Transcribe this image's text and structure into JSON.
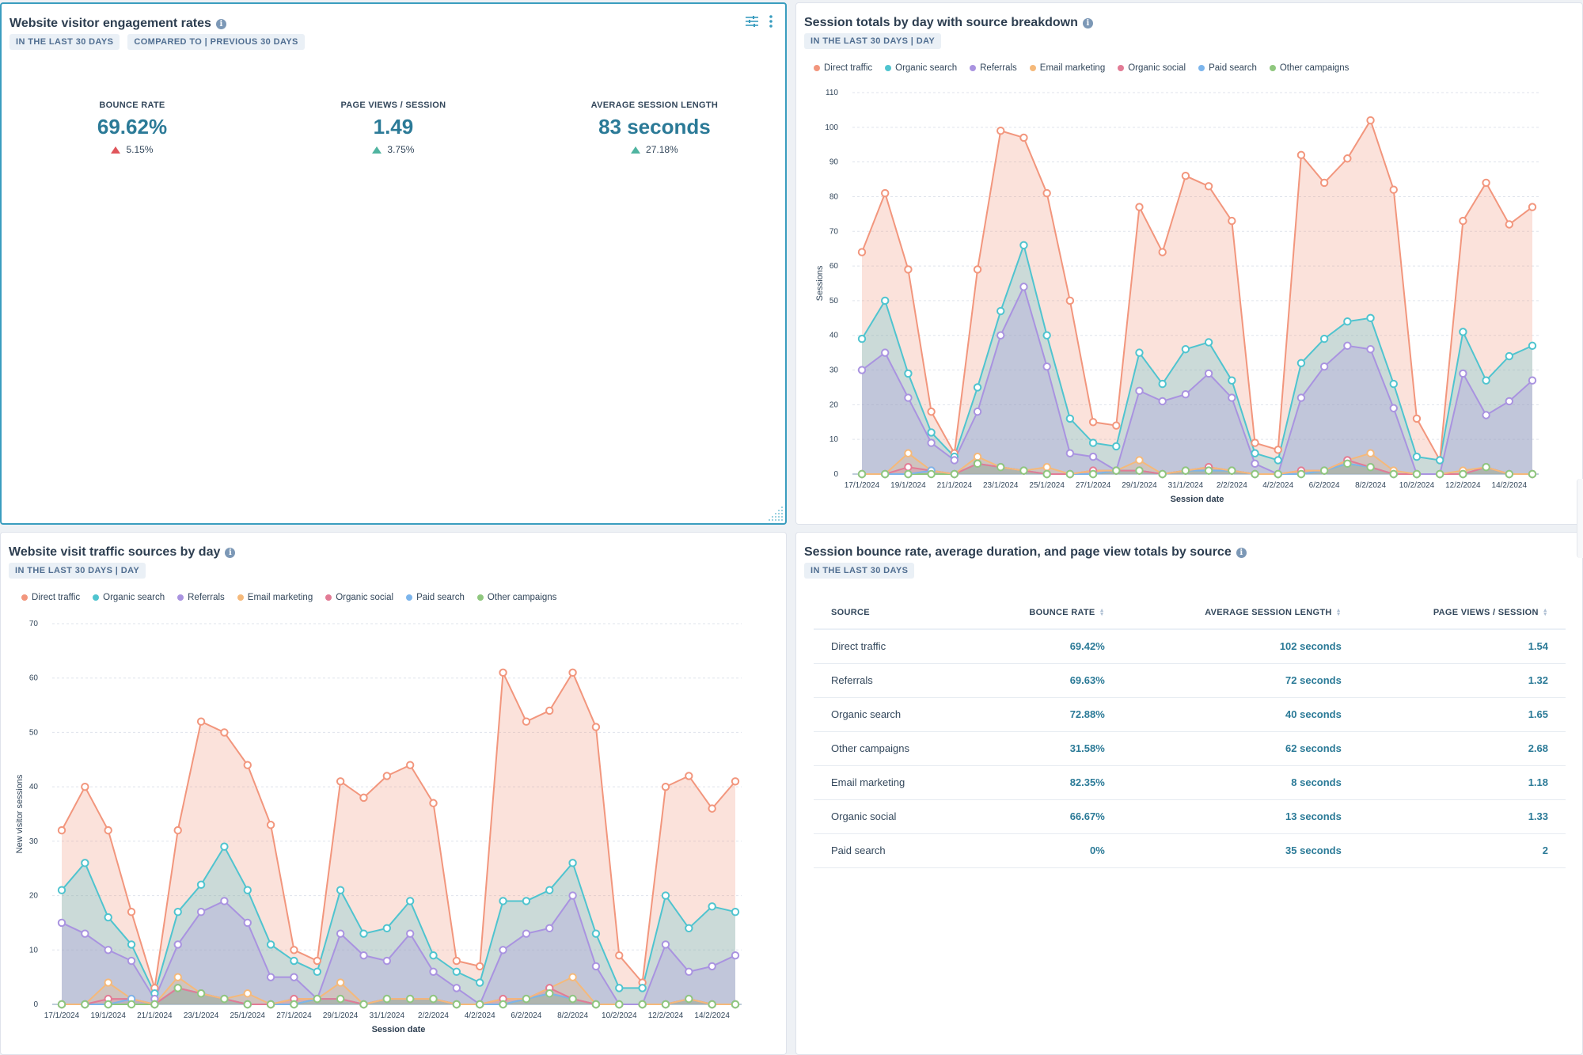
{
  "engagement": {
    "title": "Website visitor engagement rates",
    "tags": [
      "IN THE LAST 30 DAYS",
      "COMPARED TO | PREVIOUS 30 DAYS"
    ],
    "kpis": [
      {
        "label": "BOUNCE RATE",
        "value": "69.62%",
        "change": "5.15%",
        "direction": "up",
        "sentiment": "negative"
      },
      {
        "label": "PAGE VIEWS / SESSION",
        "value": "1.49",
        "change": "3.75%",
        "direction": "up",
        "sentiment": "positive"
      },
      {
        "label": "AVERAGE SESSION LENGTH",
        "value": "83 seconds",
        "change": "27.18%",
        "direction": "up",
        "sentiment": "positive"
      }
    ],
    "icons": {
      "filter": "sliders-icon",
      "menu": "more-vertical-icon"
    }
  },
  "legend": [
    {
      "name": "Direct traffic",
      "color": "#f2967d"
    },
    {
      "name": "Organic search",
      "color": "#4fc4cf"
    },
    {
      "name": "Referrals",
      "color": "#a993e0"
    },
    {
      "name": "Email marketing",
      "color": "#f5b97a"
    },
    {
      "name": "Organic social",
      "color": "#e27b95"
    },
    {
      "name": "Paid search",
      "color": "#7cb5ec"
    },
    {
      "name": "Other campaigns",
      "color": "#8fc77e"
    }
  ],
  "sessions_card": {
    "title": "Session totals by day with source breakdown",
    "tags": [
      "IN THE LAST 30 DAYS | DAY"
    ]
  },
  "traffic_card": {
    "title": "Website visit traffic sources by day",
    "tags": [
      "IN THE LAST 30 DAYS | DAY"
    ]
  },
  "chart_data": [
    {
      "type": "area",
      "stacked": true,
      "title": "Session totals by day with source breakdown",
      "xlabel": "Session date",
      "ylabel": "Sessions",
      "ylim": [
        0,
        110
      ],
      "yticks": [
        0,
        10,
        20,
        30,
        40,
        50,
        60,
        70,
        80,
        90,
        100,
        110
      ],
      "grid": true,
      "legend": "top-left",
      "x": [
        "17/1/2024",
        "18/1/2024",
        "19/1/2024",
        "20/1/2024",
        "21/1/2024",
        "22/1/2024",
        "23/1/2024",
        "24/1/2024",
        "25/1/2024",
        "26/1/2024",
        "27/1/2024",
        "28/1/2024",
        "29/1/2024",
        "30/1/2024",
        "31/1/2024",
        "1/2/2024",
        "2/2/2024",
        "3/2/2024",
        "4/2/2024",
        "5/2/2024",
        "6/2/2024",
        "7/2/2024",
        "8/2/2024",
        "9/2/2024",
        "10/2/2024",
        "11/2/2024",
        "12/2/2024",
        "13/2/2024",
        "14/2/2024",
        "15/2/2024"
      ],
      "xtick_labels": [
        "17/1/2024",
        "19/1/2024",
        "21/1/2024",
        "23/1/2024",
        "25/1/2024",
        "27/1/2024",
        "29/1/2024",
        "31/1/2024",
        "2/2/2024",
        "4/2/2024",
        "6/2/2024",
        "8/2/2024",
        "10/2/2024",
        "12/2/2024",
        "14/2/2024"
      ],
      "series": [
        {
          "name": "Other campaigns",
          "values": [
            0,
            0,
            0,
            0,
            0,
            3,
            2,
            1,
            0,
            0,
            0,
            1,
            1,
            0,
            1,
            1,
            1,
            0,
            0,
            0,
            1,
            3,
            2,
            0,
            0,
            0,
            0,
            2,
            0,
            0
          ]
        },
        {
          "name": "Paid search",
          "values": [
            0,
            0,
            0,
            1,
            0,
            0,
            0,
            0,
            0,
            0,
            0,
            0,
            0,
            0,
            0,
            0,
            0,
            0,
            0,
            0,
            0,
            0,
            0,
            0,
            0,
            0,
            0,
            0,
            0,
            0
          ]
        },
        {
          "name": "Organic social",
          "values": [
            0,
            0,
            2,
            0,
            0,
            0,
            0,
            0,
            0,
            0,
            1,
            0,
            0,
            0,
            0,
            1,
            0,
            0,
            0,
            1,
            0,
            1,
            0,
            0,
            0,
            0,
            0,
            0,
            0,
            0
          ]
        },
        {
          "name": "Email marketing",
          "values": [
            0,
            0,
            4,
            0,
            0,
            2,
            0,
            0,
            2,
            0,
            0,
            0,
            3,
            0,
            0,
            0,
            0,
            0,
            0,
            0,
            0,
            0,
            4,
            1,
            0,
            0,
            1,
            0,
            0,
            0
          ]
        },
        {
          "name": "Referrals",
          "values": [
            30,
            35,
            16,
            8,
            4,
            13,
            38,
            53,
            29,
            6,
            4,
            0,
            20,
            21,
            22,
            27,
            21,
            3,
            0,
            21,
            30,
            33,
            30,
            18,
            0,
            0,
            28,
            15,
            21,
            27
          ]
        },
        {
          "name": "Organic search",
          "values": [
            9,
            15,
            7,
            3,
            1,
            7,
            7,
            12,
            9,
            10,
            4,
            7,
            11,
            5,
            13,
            9,
            5,
            3,
            4,
            10,
            8,
            7,
            9,
            7,
            5,
            4,
            12,
            10,
            13,
            10
          ]
        },
        {
          "name": "Direct traffic",
          "values": [
            25,
            31,
            30,
            6,
            1,
            34,
            52,
            31,
            41,
            34,
            6,
            6,
            42,
            38,
            50,
            45,
            46,
            3,
            3,
            60,
            45,
            47,
            57,
            56,
            11,
            0,
            32,
            57,
            38,
            40
          ]
        }
      ],
      "stack_totals": [
        64,
        81,
        59,
        18,
        6,
        59,
        99,
        97,
        81,
        50,
        15,
        14,
        77,
        64,
        86,
        83,
        73,
        9,
        7,
        92,
        84,
        91,
        102,
        82,
        16,
        4,
        73,
        84,
        72,
        77
      ]
    },
    {
      "type": "area",
      "stacked": true,
      "title": "Website visit traffic sources by day",
      "xlabel": "Session date",
      "ylabel": "New visitor sessions",
      "ylim": [
        0,
        70
      ],
      "yticks": [
        0,
        10,
        20,
        30,
        40,
        50,
        60,
        70
      ],
      "grid": true,
      "legend": "top-left",
      "x": [
        "17/1/2024",
        "18/1/2024",
        "19/1/2024",
        "20/1/2024",
        "21/1/2024",
        "22/1/2024",
        "23/1/2024",
        "24/1/2024",
        "25/1/2024",
        "26/1/2024",
        "27/1/2024",
        "28/1/2024",
        "29/1/2024",
        "30/1/2024",
        "31/1/2024",
        "1/2/2024",
        "2/2/2024",
        "3/2/2024",
        "4/2/2024",
        "5/2/2024",
        "6/2/2024",
        "7/2/2024",
        "8/2/2024",
        "9/2/2024",
        "10/2/2024",
        "11/2/2024",
        "12/2/2024",
        "13/2/2024",
        "14/2/2024",
        "15/2/2024"
      ],
      "xtick_labels": [
        "17/1/2024",
        "19/1/2024",
        "21/1/2024",
        "23/1/2024",
        "25/1/2024",
        "27/1/2024",
        "29/1/2024",
        "31/1/2024",
        "2/2/2024",
        "4/2/2024",
        "6/2/2024",
        "8/2/2024",
        "10/2/2024",
        "12/2/2024",
        "14/2/2024"
      ],
      "series": [
        {
          "name": "Other campaigns",
          "values": [
            0,
            0,
            0,
            0,
            0,
            3,
            2,
            1,
            0,
            0,
            0,
            1,
            1,
            0,
            1,
            1,
            1,
            0,
            0,
            0,
            1,
            2,
            1,
            0,
            0,
            0,
            0,
            1,
            0,
            0
          ]
        },
        {
          "name": "Paid search",
          "values": [
            0,
            0,
            0,
            1,
            0,
            0,
            0,
            0,
            0,
            0,
            0,
            0,
            0,
            0,
            0,
            0,
            0,
            0,
            0,
            0,
            0,
            0,
            0,
            0,
            0,
            0,
            0,
            0,
            0,
            0
          ]
        },
        {
          "name": "Organic social",
          "values": [
            0,
            0,
            1,
            0,
            0,
            0,
            0,
            0,
            0,
            0,
            1,
            0,
            0,
            0,
            0,
            0,
            0,
            0,
            0,
            1,
            0,
            1,
            0,
            0,
            0,
            0,
            0,
            0,
            0,
            0
          ]
        },
        {
          "name": "Email marketing",
          "values": [
            0,
            0,
            3,
            0,
            0,
            2,
            0,
            0,
            2,
            0,
            0,
            0,
            3,
            0,
            0,
            0,
            0,
            0,
            0,
            0,
            0,
            0,
            4,
            0,
            0,
            0,
            0,
            0,
            0,
            0
          ]
        },
        {
          "name": "Referrals",
          "values": [
            15,
            13,
            6,
            7,
            1,
            6,
            15,
            18,
            13,
            5,
            4,
            0,
            9,
            9,
            7,
            12,
            5,
            3,
            0,
            9,
            12,
            11,
            15,
            7,
            0,
            0,
            11,
            5,
            7,
            9
          ]
        },
        {
          "name": "Organic search",
          "values": [
            6,
            13,
            6,
            3,
            1,
            6,
            5,
            10,
            6,
            6,
            3,
            5,
            8,
            4,
            6,
            6,
            3,
            3,
            4,
            9,
            6,
            7,
            6,
            6,
            3,
            3,
            9,
            8,
            11,
            8
          ]
        },
        {
          "name": "Direct traffic",
          "values": [
            11,
            14,
            16,
            6,
            1,
            15,
            30,
            21,
            23,
            22,
            2,
            2,
            20,
            25,
            28,
            25,
            28,
            2,
            3,
            42,
            33,
            33,
            35,
            38,
            6,
            1,
            20,
            28,
            18,
            24
          ]
        }
      ],
      "stack_totals": [
        32,
        40,
        32,
        17,
        3,
        32,
        52,
        50,
        44,
        33,
        10,
        8,
        41,
        38,
        42,
        44,
        37,
        8,
        7,
        61,
        52,
        54,
        61,
        51,
        9,
        4,
        40,
        42,
        36,
        41
      ]
    }
  ],
  "table_card": {
    "title": "Session bounce rate, average duration, and page view totals by source",
    "tags": [
      "IN THE LAST 30 DAYS"
    ],
    "columns": [
      "SOURCE",
      "BOUNCE RATE",
      "AVERAGE SESSION LENGTH",
      "PAGE VIEWS / SESSION"
    ],
    "rows": [
      [
        "Direct traffic",
        "69.42%",
        "102 seconds",
        "1.54"
      ],
      [
        "Referrals",
        "69.63%",
        "72 seconds",
        "1.32"
      ],
      [
        "Organic search",
        "72.88%",
        "40 seconds",
        "1.65"
      ],
      [
        "Other campaigns",
        "31.58%",
        "62 seconds",
        "2.68"
      ],
      [
        "Email marketing",
        "82.35%",
        "8 seconds",
        "1.18"
      ],
      [
        "Organic social",
        "66.67%",
        "13 seconds",
        "1.33"
      ],
      [
        "Paid search",
        "0%",
        "35 seconds",
        "2"
      ]
    ]
  }
}
